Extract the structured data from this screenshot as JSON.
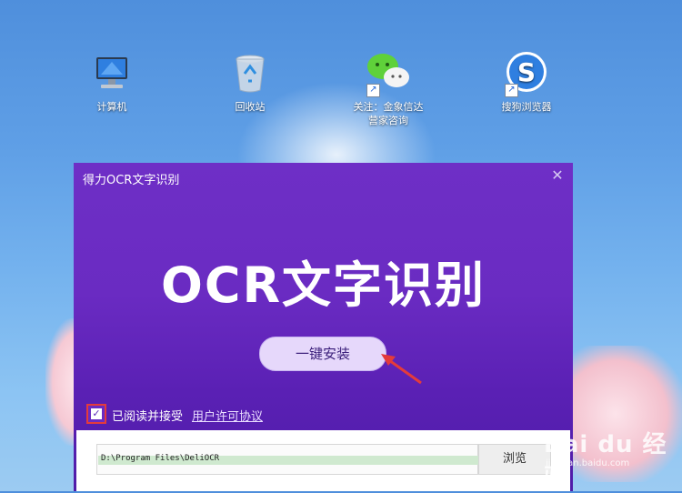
{
  "desktop": {
    "icons": [
      {
        "label": "计算机",
        "icon": "computer-icon"
      },
      {
        "label": "回收站",
        "icon": "recycle-bin-icon"
      },
      {
        "label": "关注：金象信达营家咨询",
        "icon": "wechat-icon"
      },
      {
        "label": "搜狗浏览器",
        "icon": "sogou-browser-icon"
      }
    ]
  },
  "dialog": {
    "title": "得力OCR文字识别",
    "close_glyph": "✕",
    "logo_text": "OCR文字识别",
    "install_label": "一键安装",
    "agree_checked": true,
    "agree_text": "已阅读并接受",
    "license_link": "用户许可协议",
    "install_path": "D:\\Program Files\\DeliOCR",
    "browse_label": "浏览"
  },
  "watermark": {
    "brand": "Bai du 经验",
    "url": "jingyan.baidu.com"
  },
  "colors": {
    "dialog_bg": "#6a2bc2",
    "highlight": "#e43b3b",
    "install_button": "#e6d8fb"
  }
}
